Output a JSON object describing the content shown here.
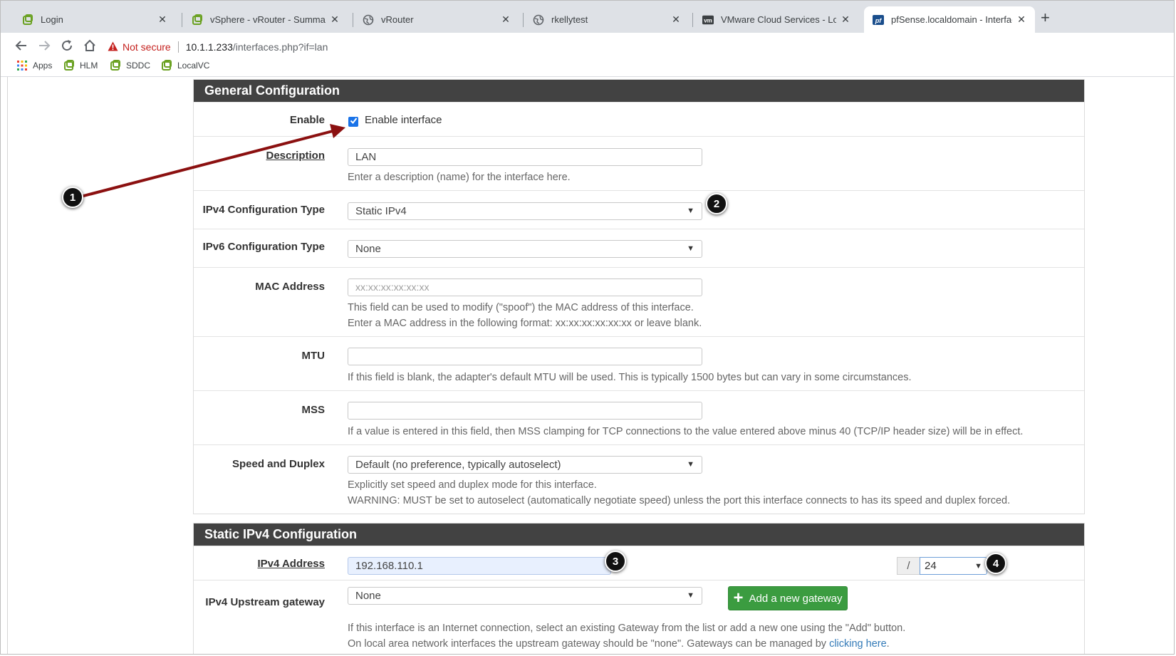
{
  "browser": {
    "tabs": [
      {
        "title": "Login",
        "favicon": "green-leaf-icon",
        "active": false
      },
      {
        "title": "vSphere - vRouter - Summary",
        "favicon": "green-leaf-icon",
        "active": false
      },
      {
        "title": "vRouter",
        "favicon": "globe-icon",
        "active": false
      },
      {
        "title": "rkellytest",
        "favicon": "globe-icon",
        "active": false
      },
      {
        "title": "VMware Cloud Services - Log In",
        "favicon": "vm-icon",
        "active": false
      },
      {
        "title": "pfSense.localdomain - Interfaces",
        "favicon": "pf-icon",
        "active": true
      }
    ],
    "close_glyph": "✕",
    "new_tab_glyph": "+",
    "security_label": "Not secure",
    "url_host": "10.1.1.233",
    "url_path": "/interfaces.php?if=lan",
    "bookmarks": [
      {
        "label": "Apps",
        "icon": "apps-grid-icon"
      },
      {
        "label": "HLM",
        "icon": "green-leaf-icon"
      },
      {
        "label": "SDDC",
        "icon": "green-leaf-icon"
      },
      {
        "label": "LocalVC",
        "icon": "green-leaf-icon"
      }
    ]
  },
  "general": {
    "heading": "General Configuration",
    "enable": {
      "label": "Enable",
      "checkbox_label": "Enable interface",
      "checked": true
    },
    "description": {
      "label": "Description",
      "value": "LAN",
      "help": "Enter a description (name) for the interface here."
    },
    "ipv4_type": {
      "label": "IPv4 Configuration Type",
      "value": "Static IPv4"
    },
    "ipv6_type": {
      "label": "IPv6 Configuration Type",
      "value": "None"
    },
    "mac": {
      "label": "MAC Address",
      "placeholder": "xx:xx:xx:xx:xx:xx",
      "help1": "This field can be used to modify (\"spoof\") the MAC address of this interface.",
      "help2": "Enter a MAC address in the following format: xx:xx:xx:xx:xx:xx or leave blank."
    },
    "mtu": {
      "label": "MTU",
      "value": "",
      "help": "If this field is blank, the adapter's default MTU will be used. This is typically 1500 bytes but can vary in some circumstances."
    },
    "mss": {
      "label": "MSS",
      "value": "",
      "help": "If a value is entered in this field, then MSS clamping for TCP connections to the value entered above minus 40 (TCP/IP header size) will be in effect."
    },
    "speed": {
      "label": "Speed and Duplex",
      "value": "Default (no preference, typically autoselect)",
      "help1": "Explicitly set speed and duplex mode for this interface.",
      "help2": "WARNING: MUST be set to autoselect (automatically negotiate speed) unless the port this interface connects to has its speed and duplex forced."
    }
  },
  "static_ipv4": {
    "heading": "Static IPv4 Configuration",
    "address": {
      "label": "IPv4 Address",
      "value": "192.168.110.1",
      "separator": "/",
      "mask": "24"
    },
    "gateway": {
      "label": "IPv4 Upstream gateway",
      "value": "None",
      "add_button": "Add a new gateway",
      "help1": "If this interface is an Internet connection, select an existing Gateway from the list or add a new one using the \"Add\" button.",
      "help2_prefix": "On local area network interfaces the upstream gateway should be \"none\". Gateways can be managed by ",
      "help2_link": "clicking here",
      "help2_suffix": "."
    }
  },
  "callouts": [
    "1",
    "2",
    "3",
    "4"
  ],
  "colors": {
    "annotation_arrow": "#8b1010",
    "panel_header": "#424242",
    "add_button": "#3b9c40",
    "checkbox": "#1a73e8",
    "not_secure": "#c5221f"
  }
}
